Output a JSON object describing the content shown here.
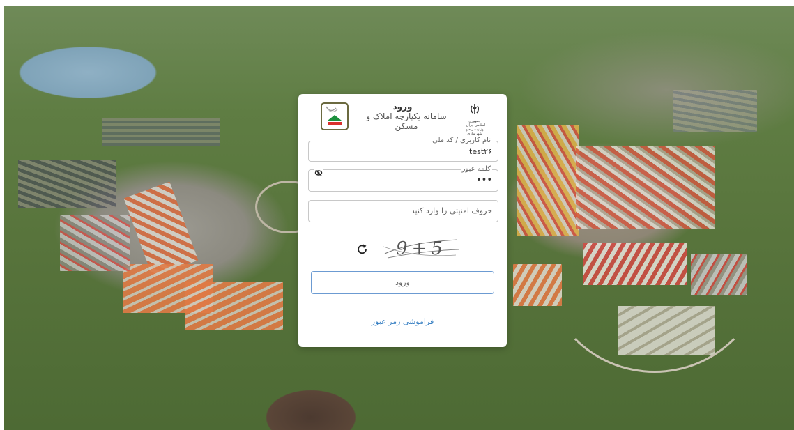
{
  "login": {
    "heading": "ورود",
    "system_name": "سامانه یکپارچه املاک و مسکن",
    "emblem_caption": "جمهوری اسلامی ایران · وزارت راه و شهرسازی",
    "username": {
      "label": "نام کاربری / کد ملی",
      "value": "test۲۶"
    },
    "password": {
      "label": "کلمه عبور",
      "value": "•••"
    },
    "captcha": {
      "placeholder": "حروف امنیتی را وارد کنید",
      "image_text": "9+5"
    },
    "submit_label": "ورود",
    "forgot_label": "فراموشی رمز عبور"
  },
  "icons": {
    "emblem": "iran-emblem-icon",
    "logo": "housing-logo-icon",
    "eye": "eye-slash-icon",
    "refresh": "refresh-icon"
  },
  "colors": {
    "link": "#3b82c4",
    "button_border": "#6c9bd2",
    "card_bg": "#ffffff"
  }
}
